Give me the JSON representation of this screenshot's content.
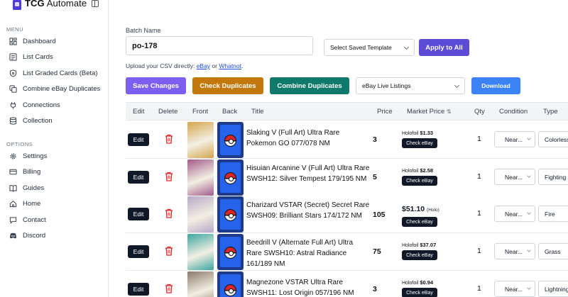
{
  "app": {
    "name_bold": "TCG",
    "name_rest": "Automate"
  },
  "sidebar": {
    "menu_label": "MENU",
    "menu_items": [
      {
        "label": "Dashboard",
        "icon": "dashboard-icon"
      },
      {
        "label": "List Cards",
        "icon": "cards-icon"
      },
      {
        "label": "List Graded Cards (Beta)",
        "icon": "shield-icon"
      },
      {
        "label": "Combine eBay Duplicates",
        "icon": "copy-icon"
      },
      {
        "label": "Connections",
        "icon": "plug-icon"
      },
      {
        "label": "Collection",
        "icon": "database-icon"
      }
    ],
    "options_label": "OPTIONS",
    "option_items": [
      {
        "label": "Settings",
        "icon": "gear-icon"
      },
      {
        "label": "Billing",
        "icon": "credit-card-icon"
      },
      {
        "label": "Guides",
        "icon": "book-icon"
      },
      {
        "label": "Home",
        "icon": "home-icon"
      },
      {
        "label": "Contact",
        "icon": "chat-icon"
      },
      {
        "label": "Discord",
        "icon": "discord-icon"
      }
    ]
  },
  "batch": {
    "label": "Batch Name",
    "value": "po-178"
  },
  "template_select": {
    "value": "Select Saved Template"
  },
  "apply_all_label": "Apply to All",
  "upload": {
    "prefix": "Upload your CSV directly: ",
    "link1": "eBay",
    "mid": " or ",
    "link2": "Whatnot",
    "suffix": "."
  },
  "actions": {
    "save": "Save Changes",
    "check": "Check Duplicates",
    "combine": "Combine Duplicates",
    "listing_select": "eBay Live Listings",
    "download": "Download"
  },
  "colors": {
    "accent": "#5b4bd6",
    "save": "#7c5ff0",
    "check": "#c2780a",
    "combine": "#0f7a6b",
    "download": "#3b82f6"
  },
  "table": {
    "headers": [
      "Edit",
      "Delete",
      "Front",
      "Back",
      "Title",
      "Price",
      "Market Price",
      "Qty",
      "Condition",
      "Type"
    ],
    "sort_icon": "⇅",
    "rows": [
      {
        "edit": "Edit",
        "title": "Slaking V (Full Art) Ultra Rare Pokemon GO 077/078 NM",
        "price": "3",
        "mp_label": "Holofoil",
        "mp_value": "$1.33",
        "mp_style": "small",
        "check": "Check eBay",
        "qty": "1",
        "condition": "Near...",
        "type": "Colorless",
        "front": "#d4a54a"
      },
      {
        "edit": "Edit",
        "title": "Hisuian Arcanine V (Full Art) Ultra Rare SWSH12: Silver Tempest 179/195 NM",
        "price": "5",
        "mp_label": "Holofoil",
        "mp_value": "$2.58",
        "mp_style": "small",
        "check": "Check eBay",
        "qty": "1",
        "condition": "Near...",
        "type": "Fighting",
        "front": "#a35a8c"
      },
      {
        "edit": "Edit",
        "title": "Charizard VSTAR (Secret) Secret Rare SWSH09: Brilliant Stars 174/172 NM",
        "price": "105",
        "mp_label": "(Holo)",
        "mp_value": "$51.10",
        "mp_style": "big",
        "check": "Check eBay",
        "qty": "1",
        "condition": "Near...",
        "type": "Fire",
        "front": "#b6a9c8"
      },
      {
        "edit": "Edit",
        "title": "Beedrill V (Alternate Full Art) Ultra Rare SWSH10: Astral Radiance 161/189 NM",
        "price": "75",
        "mp_label": "Holofoil",
        "mp_value": "$37.07",
        "mp_style": "small",
        "check": "Check eBay",
        "qty": "1",
        "condition": "Near...",
        "type": "Grass",
        "front": "#3aa6a0"
      },
      {
        "edit": "Edit",
        "title": "Magnezone VSTAR Ultra Rare SWSH11: Lost Origin 057/196 NM",
        "price": "3",
        "mp_label": "Holofoil",
        "mp_value": "$0.94",
        "mp_style": "small",
        "check": "Check eBay",
        "qty": "1",
        "condition": "Near...",
        "type": "Lightning",
        "front": "#8a7a6a"
      }
    ]
  }
}
